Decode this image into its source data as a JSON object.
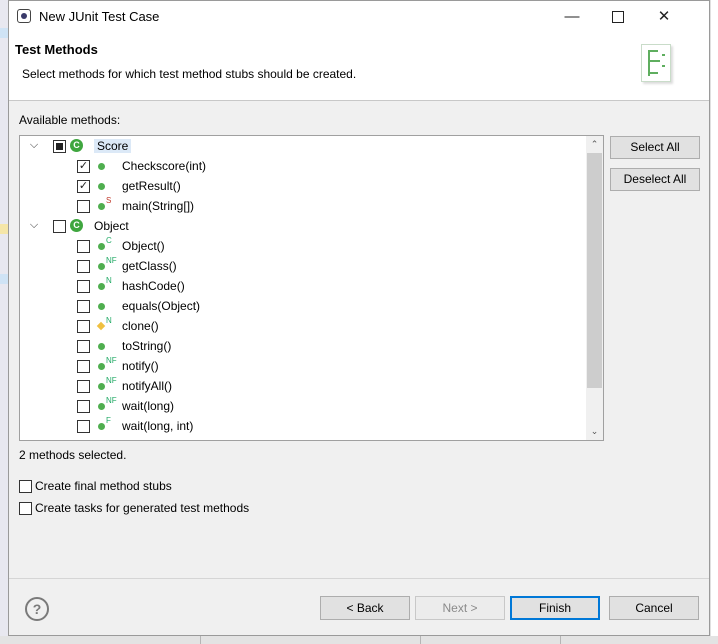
{
  "window": {
    "title": "New JUnit Test Case",
    "min_glyph": "—",
    "close_glyph": "✕"
  },
  "header": {
    "title": "Test Methods",
    "description": "Select methods for which test method stubs should be created."
  },
  "tree": {
    "label": "Available methods:",
    "twisty_glyph": "⌵",
    "scroll_up": "⌃",
    "scroll_down": "⌄",
    "rows": [
      {
        "label": "Score",
        "level": 0,
        "checked": "partial",
        "icon": "class-icon",
        "badge": ""
      },
      {
        "label": "Checkscore(int)",
        "level": 1,
        "checked": true,
        "icon": "public-method-icon",
        "badge": ""
      },
      {
        "label": "getResult()",
        "level": 1,
        "checked": true,
        "icon": "public-method-icon",
        "badge": ""
      },
      {
        "label": "main(String[])",
        "level": 1,
        "checked": false,
        "icon": "public-method-icon",
        "badge": "S"
      },
      {
        "label": "Object",
        "level": 0,
        "checked": false,
        "icon": "class-icon",
        "badge": ""
      },
      {
        "label": "Object()",
        "level": 1,
        "checked": false,
        "icon": "public-method-icon",
        "badge": "C"
      },
      {
        "label": "getClass()",
        "level": 1,
        "checked": false,
        "icon": "public-method-icon",
        "badge": "NF"
      },
      {
        "label": "hashCode()",
        "level": 1,
        "checked": false,
        "icon": "public-method-icon",
        "badge": "N"
      },
      {
        "label": "equals(Object)",
        "level": 1,
        "checked": false,
        "icon": "public-method-icon",
        "badge": ""
      },
      {
        "label": "clone()",
        "level": 1,
        "checked": false,
        "icon": "protected-method-icon",
        "badge": "N"
      },
      {
        "label": "toString()",
        "level": 1,
        "checked": false,
        "icon": "public-method-icon",
        "badge": ""
      },
      {
        "label": "notify()",
        "level": 1,
        "checked": false,
        "icon": "public-method-icon",
        "badge": "NF"
      },
      {
        "label": "notifyAll()",
        "level": 1,
        "checked": false,
        "icon": "public-method-icon",
        "badge": "NF"
      },
      {
        "label": "wait(long)",
        "level": 1,
        "checked": false,
        "icon": "public-method-icon",
        "badge": "NF"
      },
      {
        "label": "wait(long, int)",
        "level": 1,
        "checked": false,
        "icon": "public-method-icon",
        "badge": "F"
      }
    ]
  },
  "buttons": {
    "select_all": "Select All",
    "deselect_all": "Deselect All",
    "back": "< Back",
    "next": "Next >",
    "finish": "Finish",
    "cancel": "Cancel"
  },
  "status": {
    "selected_count": "2 methods selected."
  },
  "options": [
    {
      "label": "Create final method stubs",
      "checked": false
    },
    {
      "label": "Create tasks for generated test methods",
      "checked": false
    }
  ],
  "help": {
    "glyph": "?"
  },
  "colors": {
    "accent": "#0078d7",
    "method_public": "#4fae4f",
    "method_protected": "#f0c040"
  }
}
